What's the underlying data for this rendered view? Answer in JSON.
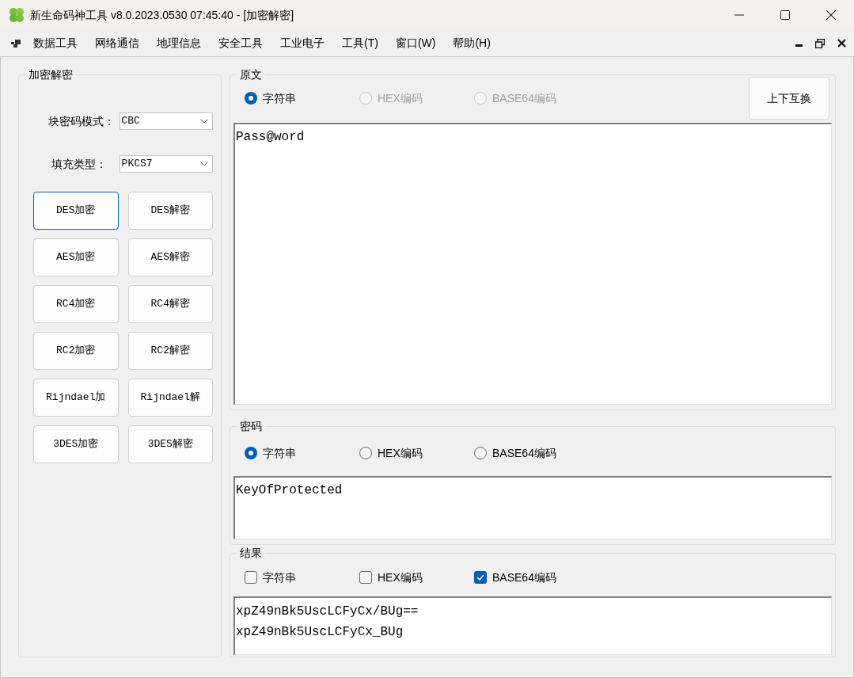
{
  "window": {
    "title": "新生命码神工具 v8.0.2023.0530 07:45:40 - [加密解密]"
  },
  "menu": {
    "items": [
      "数据工具",
      "网络通信",
      "地理信息",
      "安全工具",
      "工业电子",
      "工具(T)",
      "窗口(W)",
      "帮助(H)"
    ]
  },
  "crypto": {
    "title": "加密解密",
    "fields": [
      {
        "label": "块密码模式：",
        "value": "CBC"
      },
      {
        "label": "填充类型：",
        "value": "PKCS7"
      }
    ],
    "buttons": [
      {
        "label": "DES加密",
        "focused": true
      },
      {
        "label": "DES解密",
        "focused": false
      },
      {
        "label": "AES加密",
        "focused": false
      },
      {
        "label": "AES解密",
        "focused": false
      },
      {
        "label": "RC4加密",
        "focused": false
      },
      {
        "label": "RC4解密",
        "focused": false
      },
      {
        "label": "RC2加密",
        "focused": false
      },
      {
        "label": "RC2解密",
        "focused": false
      },
      {
        "label": "Rijndael加",
        "focused": false
      },
      {
        "label": "Rijndael解",
        "focused": false
      },
      {
        "label": "3DES加密",
        "focused": false
      },
      {
        "label": "3DES解密",
        "focused": false
      }
    ]
  },
  "source": {
    "title": "原文",
    "swap_button": "上下互换",
    "options": [
      {
        "label": "字符串",
        "selected": true,
        "disabled": false
      },
      {
        "label": "HEX编码",
        "selected": false,
        "disabled": true
      },
      {
        "label": "BASE64编码",
        "selected": false,
        "disabled": true
      }
    ],
    "text": "Pass@word"
  },
  "key": {
    "title": "密码",
    "options": [
      {
        "label": "字符串",
        "selected": true,
        "disabled": false
      },
      {
        "label": "HEX编码",
        "selected": false,
        "disabled": false
      },
      {
        "label": "BASE64编码",
        "selected": false,
        "disabled": false
      }
    ],
    "text": "KeyOfProtected"
  },
  "result": {
    "title": "结果",
    "options": [
      {
        "label": "字符串",
        "checked": false
      },
      {
        "label": "HEX编码",
        "checked": false
      },
      {
        "label": "BASE64编码",
        "checked": true
      }
    ],
    "lines": [
      "xpZ49nBk5UscLCFyCx/BUg==",
      "xpZ49nBk5UscLCFyCx_BUg"
    ]
  }
}
